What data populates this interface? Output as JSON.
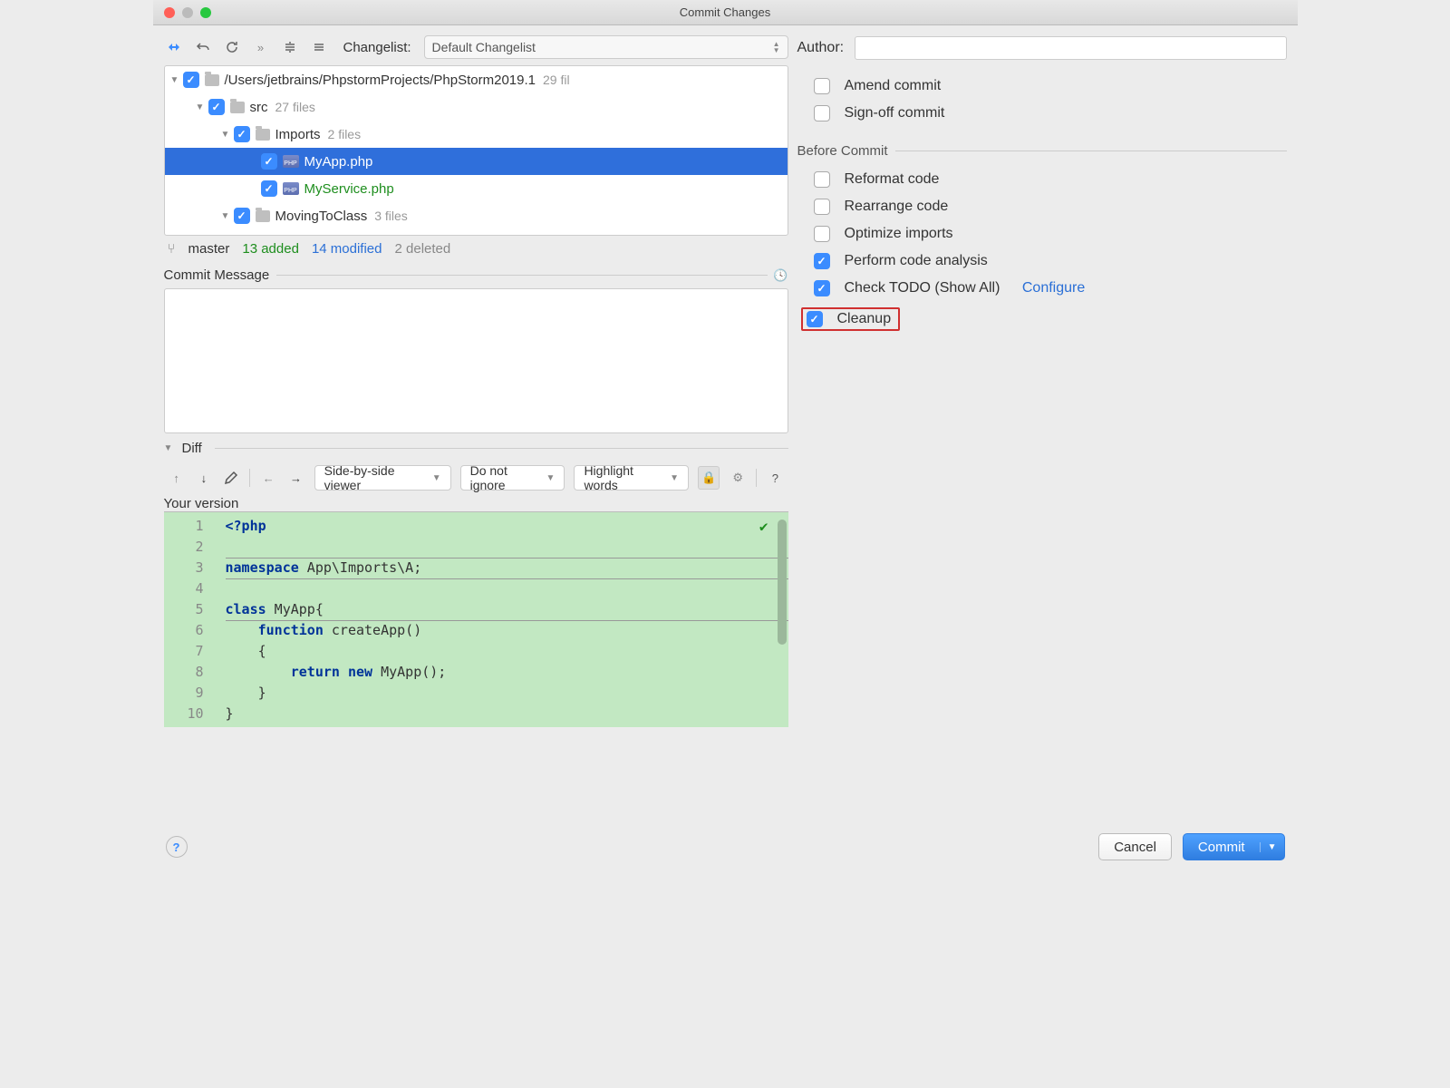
{
  "window": {
    "title": "Commit Changes"
  },
  "toolbar": {
    "changelist_label": "Changelist:",
    "changelist_value": "Default Changelist"
  },
  "tree": {
    "root": {
      "path": "/Users/jetbrains/PhpstormProjects/PhpStorm2019.1",
      "meta": "29 fil"
    },
    "src": {
      "name": "src",
      "meta": "27 files"
    },
    "imports": {
      "name": "Imports",
      "meta": "2 files"
    },
    "myapp": {
      "name": "MyApp.php"
    },
    "myservice": {
      "name": "MyService.php"
    },
    "moving": {
      "name": "MovingToClass",
      "meta": "3 files"
    }
  },
  "status": {
    "branch": "master",
    "added": "13 added",
    "modified": "14 modified",
    "deleted": "2 deleted"
  },
  "commit_msg": {
    "label": "Commit Message"
  },
  "diff": {
    "label": "Diff",
    "viewer": "Side-by-side viewer",
    "ignore": "Do not ignore",
    "highlight": "Highlight words",
    "yourver": "Your version"
  },
  "code": {
    "l1a": "<?php",
    "l3a": "namespace",
    "l3b": " App\\Imports\\A;",
    "l5a": "class",
    "l5b": " MyApp{",
    "l6a": "function",
    "l6b": " createApp()",
    "l7": "{",
    "l8a": "return new",
    "l8b": " MyApp();",
    "l9": "}",
    "l10": "}"
  },
  "gutter": {
    "n1": "1",
    "n2": "2",
    "n3": "3",
    "n4": "4",
    "n5": "5",
    "n6": "6",
    "n7": "7",
    "n8": "8",
    "n9": "9",
    "n10": "10"
  },
  "right": {
    "author_label": "Author:",
    "amend": "Amend commit",
    "signoff": "Sign-off commit",
    "before_label": "Before Commit",
    "reformat": "Reformat code",
    "rearrange": "Rearrange code",
    "optimize": "Optimize imports",
    "analysis": "Perform code analysis",
    "todo": "Check TODO (Show All)",
    "configure": "Configure",
    "cleanup": "Cleanup"
  },
  "footer": {
    "cancel": "Cancel",
    "commit": "Commit"
  }
}
